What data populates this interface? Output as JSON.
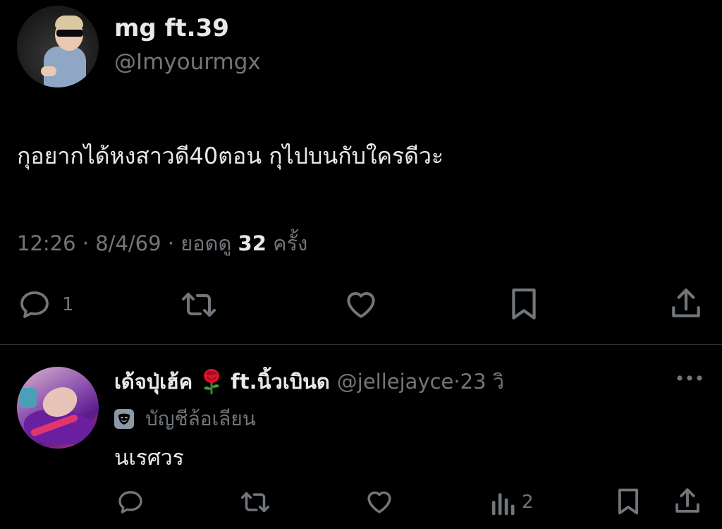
{
  "main_tweet": {
    "display_name": "mg ft.39",
    "handle": "@Imyourmgx",
    "text": "กุอยากได้หงสาวดี40ตอน กุไปบนกับใครดีวะ",
    "time": "12:26",
    "date": "8/4/69",
    "views_label": "ยอดดู",
    "views_count": "32",
    "views_suffix": "ครั้ง",
    "reply_count": "1"
  },
  "reply": {
    "display_name": "เด้จปุ่เฮ้ค",
    "display_name_suffix": "ft.นิ้วเบินด",
    "handle": "@jellejayce",
    "time": "23 วิ",
    "label": "บัญชีล้อเลียน",
    "text": "นเรศวร",
    "views_count": "2"
  },
  "icons": {
    "reply": "reply-icon",
    "retweet": "retweet-icon",
    "like": "heart-icon",
    "bookmark": "bookmark-icon",
    "share": "share-icon",
    "views": "views-icon",
    "more": "more-icon",
    "rose": "rose-emoji-icon",
    "parody": "parody-mask-icon"
  },
  "colors": {
    "background": "#000000",
    "text": "#e7e9ea",
    "muted": "#71767b",
    "divider": "#2f3336"
  }
}
